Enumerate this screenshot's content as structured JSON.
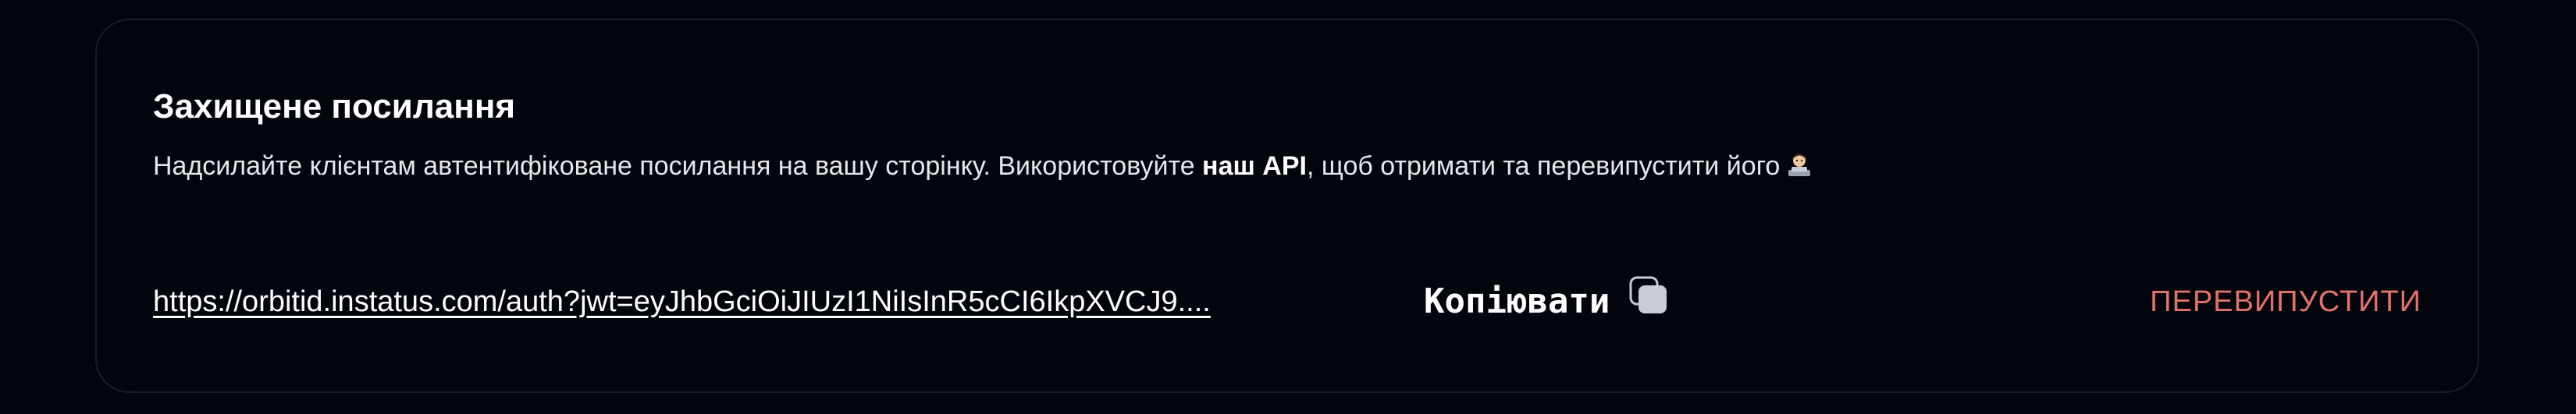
{
  "section": {
    "title": "Захищене посилання",
    "description_before": "Надсилайте клієнтам автентифіковане посилання на вашу сторінку. Використовуйте ",
    "description_api": "наш API",
    "description_after": ", щоб отримати та перевипустити його",
    "emoji_icon": "technologist-emoji-icon"
  },
  "link": {
    "text": "https://orbitid.instatus.com/auth?jwt=eyJhbGciOiJIUzI1NiIsInR5cCI6IkpXVCJ9...."
  },
  "actions": {
    "copy_label": "Копіювати",
    "copy_icon": "copy-icon",
    "reissue_label": "ПЕРЕВИПУСТИТИ"
  },
  "colors": {
    "background": "#03050c",
    "card_border": "#1a1e2a",
    "text": "#ffffff",
    "danger_accent": "#e2726a"
  }
}
